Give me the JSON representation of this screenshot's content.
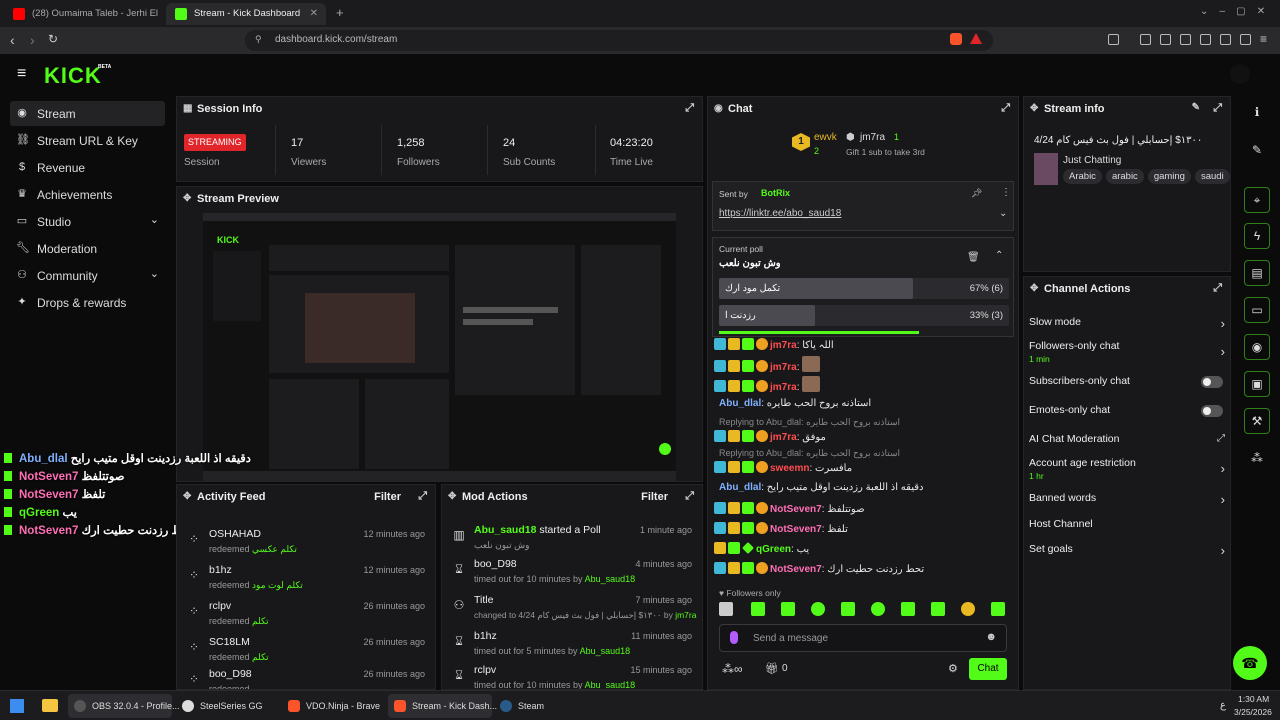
{
  "browser": {
    "tabs": [
      {
        "title": "(28) Oumaima Taleb - Jerhi El Ba..."
      },
      {
        "title": "Stream - Kick Dashboard"
      }
    ],
    "url": "dashboard.kick.com/stream"
  },
  "app": {
    "logo": "KICK",
    "beta": "BETA"
  },
  "sidebar": {
    "items": [
      {
        "label": "Stream",
        "icon": "stream-icon"
      },
      {
        "label": "Stream URL & Key",
        "icon": "link-icon"
      },
      {
        "label": "Revenue",
        "icon": "money-icon"
      },
      {
        "label": "Achievements",
        "icon": "trophy-icon"
      },
      {
        "label": "Studio",
        "icon": "studio-icon"
      },
      {
        "label": "Moderation",
        "icon": "wrench-icon"
      },
      {
        "label": "Community",
        "icon": "users-icon"
      },
      {
        "label": "Drops & rewards",
        "icon": "gift-icon"
      }
    ]
  },
  "session": {
    "title": "Session Info",
    "status": "STREAMING",
    "status_label": "Session",
    "stats": [
      {
        "value": "17",
        "label": "Viewers"
      },
      {
        "value": "1,258",
        "label": "Followers"
      },
      {
        "value": "24",
        "label": "Sub Counts"
      },
      {
        "value": "04:23:20",
        "label": "Time Live"
      }
    ]
  },
  "preview": {
    "title": "Stream Preview"
  },
  "overlay_chat": [
    {
      "user": "Abu_dlal",
      "text": "دقيقه اذ اللعبة رزدينت اوقل متيب رايح",
      "color": "blue"
    },
    {
      "user": "NotSeven7",
      "text": "صوتتلفظ",
      "color": "pink"
    },
    {
      "user": "NotSeven7",
      "text": "تلفظ",
      "color": "pink"
    },
    {
      "user": "qGreen",
      "text": "يب",
      "color": "green"
    },
    {
      "user": "NotSeven7",
      "text": "تحط رزدنت حطيت ارك",
      "color": "pink"
    }
  ],
  "activity": {
    "title": "Activity Feed",
    "filter": "Filter",
    "rows": [
      {
        "name": "OSHAHAD",
        "action": "redeemed",
        "reward": "تكلم عكسي",
        "time": "12 minutes ago"
      },
      {
        "name": "b1hz",
        "action": "redeemed",
        "reward": "تكلم لوت مود",
        "time": "12 minutes ago"
      },
      {
        "name": "rclpv",
        "action": "redeemed",
        "reward": "تكلم",
        "time": "26 minutes ago"
      },
      {
        "name": "SC18LM",
        "action": "redeemed",
        "reward": "تكلم",
        "time": "26 minutes ago"
      },
      {
        "name": "boo_D98",
        "action": "redeemed",
        "reward": "",
        "time": "26 minutes ago"
      }
    ]
  },
  "mod": {
    "title": "Mod Actions",
    "filter": "Filter",
    "rows": [
      {
        "name": "Abu_saud18",
        "verb": "started a Poll",
        "detail": "وش تبون نلعب",
        "by": "",
        "time": "1 minute ago"
      },
      {
        "name": "boo_D98",
        "verb": "",
        "detail": "timed out for 10 minutes by",
        "by": "Abu_saud18",
        "time": "4 minutes ago"
      },
      {
        "name": "Title",
        "verb": "",
        "detail": "changed to 4/24 ١٣٠٠$ إحسابلي | فول بث فيس كام",
        "by": "jm7ra",
        "time": "7 minutes ago"
      },
      {
        "name": "b1hz",
        "verb": "",
        "detail": "timed out for 5 minutes by",
        "by": "Abu_saud18",
        "time": "11 minutes ago"
      },
      {
        "name": "rclpv",
        "verb": "",
        "detail": "timed out for 10 minutes by",
        "by": "Abu_saud18",
        "time": "15 minutes ago"
      }
    ]
  },
  "chat": {
    "title": "Chat",
    "top": [
      {
        "name": "ewvk",
        "count": "2"
      },
      {
        "name": "jm7ra",
        "count": "1"
      }
    ],
    "gift_text": "Gift 1 sub to take 3rd",
    "pinned_by_label": "Sent by",
    "pinned_by": "BotRix",
    "pinned_link": "https://linktr.ee/abo_saud18",
    "poll": {
      "label": "Current poll",
      "question": "وش تبون نلعب",
      "options": [
        {
          "text": "تكمل مود ارك",
          "pct": "67% (6)",
          "frac": 0.67
        },
        {
          "text": "رزدنت ا",
          "pct": "33% (3)",
          "frac": 0.33
        }
      ]
    },
    "messages": [
      {
        "user": "jm7ra",
        "color": "red",
        "text": "اللہ یاکا"
      },
      {
        "user": "jm7ra",
        "color": "red",
        "text": ""
      },
      {
        "user": "jm7ra",
        "color": "red",
        "text": ""
      },
      {
        "user": "Abu_dlal",
        "color": "blue",
        "text": "استاذنه بروح الحب طايره"
      },
      {
        "reply": "Replying to Abu_dlal: استاذنه بروح الحب طايره"
      },
      {
        "user": "jm7ra",
        "color": "red",
        "text": "موفق"
      },
      {
        "reply": "Replying to Abu_dlal: استاذنه بروح الحب طايره"
      },
      {
        "user": "sweemn",
        "color": "red",
        "text": "مافسرت"
      },
      {
        "user": "Abu_dlal",
        "color": "blue",
        "text": "دقيقه اذ اللعبة رزدينت اوقل متيب رايح"
      },
      {
        "user": "NotSeven7",
        "color": "pink",
        "text": "صوتتلفظ"
      },
      {
        "user": "NotSeven7",
        "color": "pink",
        "text": "تلفظ"
      },
      {
        "user": "qGreen",
        "color": "green",
        "text": "يب"
      },
      {
        "user": "NotSeven7",
        "color": "pink",
        "text": "تحط رزدنت حطيت ارك"
      }
    ],
    "followers_only": "Followers only",
    "input_placeholder": "Send a message",
    "points": "0",
    "send_label": "Chat"
  },
  "stream_info": {
    "title": "Stream info",
    "stream_title": "4/24 ١٣٠٠$ إحسابلي | فول بث فيس كام",
    "category": "Just Chatting",
    "tags": [
      "Arabic",
      "arabic",
      "gaming",
      "saudi"
    ]
  },
  "channel_actions": {
    "title": "Channel Actions",
    "rows": [
      {
        "label": "Slow mode",
        "sub": "",
        "control": "arrow"
      },
      {
        "label": "Followers-only chat",
        "sub": "1 min",
        "control": "arrow"
      },
      {
        "label": "Subscribers-only chat",
        "sub": "",
        "control": "toggle"
      },
      {
        "label": "Emotes-only chat",
        "sub": "",
        "control": "toggle"
      },
      {
        "label": "AI Chat Moderation",
        "sub": "",
        "control": "external"
      },
      {
        "label": "Account age restriction",
        "sub": "1 hr",
        "control": "arrow"
      },
      {
        "label": "Banned words",
        "sub": "",
        "control": "arrow"
      },
      {
        "label": "Host Channel",
        "sub": "",
        "control": "none"
      },
      {
        "label": "Set goals",
        "sub": "",
        "control": "arrow"
      }
    ]
  },
  "taskbar": {
    "apps": [
      {
        "label": "OBS 32.0.4 - Profile..."
      },
      {
        "label": "SteelSeries GG"
      },
      {
        "label": "VDO.Ninja - Brave"
      },
      {
        "label": "Stream - Kick Dash..."
      },
      {
        "label": "Steam"
      }
    ],
    "time": "1:30 AM",
    "date": "3/25/2026",
    "lang": "ع"
  },
  "colors": {
    "accent": "#53fc18",
    "live": "#e0262b",
    "panel": "#18181a"
  }
}
